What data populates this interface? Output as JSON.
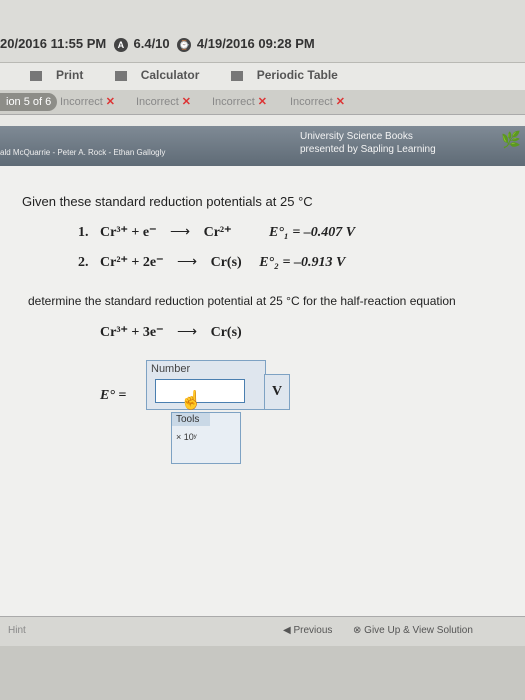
{
  "status": {
    "date_left": "20/2016 11:55 PM",
    "badge_a": "A",
    "score": "6.4/10",
    "badge_clock": "⌚",
    "date_right": "4/19/2016 09:28 PM"
  },
  "toolbar": {
    "print": "Print",
    "calculator": "Calculator",
    "periodic_table": "Periodic Table"
  },
  "question_nav": {
    "current": "ion 5 of 6",
    "attempts": [
      "Incorrect",
      "Incorrect",
      "Incorrect",
      "Incorrect"
    ]
  },
  "banner": {
    "authors": "ald McQuarrie - Peter A. Rock - Ethan Gallogly",
    "publisher_line1": "University Science Books",
    "publisher_line2": "presented by Sapling Learning"
  },
  "content": {
    "intro": "Given these standard reduction potentials at 25 °C",
    "eq1_label": "1.",
    "eq1_left": "Cr³⁺ + e⁻",
    "eq1_right": "Cr²⁺",
    "eq1_value": "E°₁ = –0.407  V",
    "eq2_label": "2.",
    "eq2_left": "Cr²⁺ + 2e⁻",
    "eq2_right": "Cr(s)",
    "eq2_value": "E°₂ = –0.913  V",
    "determine": "determine the standard reduction potential at 25 °C for the half-reaction equation",
    "target_left": "Cr³⁺ + 3e⁻",
    "target_right": "Cr(s)",
    "arrow": "⟶"
  },
  "answer": {
    "label": "E° =",
    "box_header": "Number",
    "unit": "V",
    "tools_tab": "Tools",
    "tools_button": "× 10ʸ"
  },
  "footer": {
    "hint": "Hint",
    "previous": "Previous",
    "give_up": "Give Up & View Solution"
  }
}
